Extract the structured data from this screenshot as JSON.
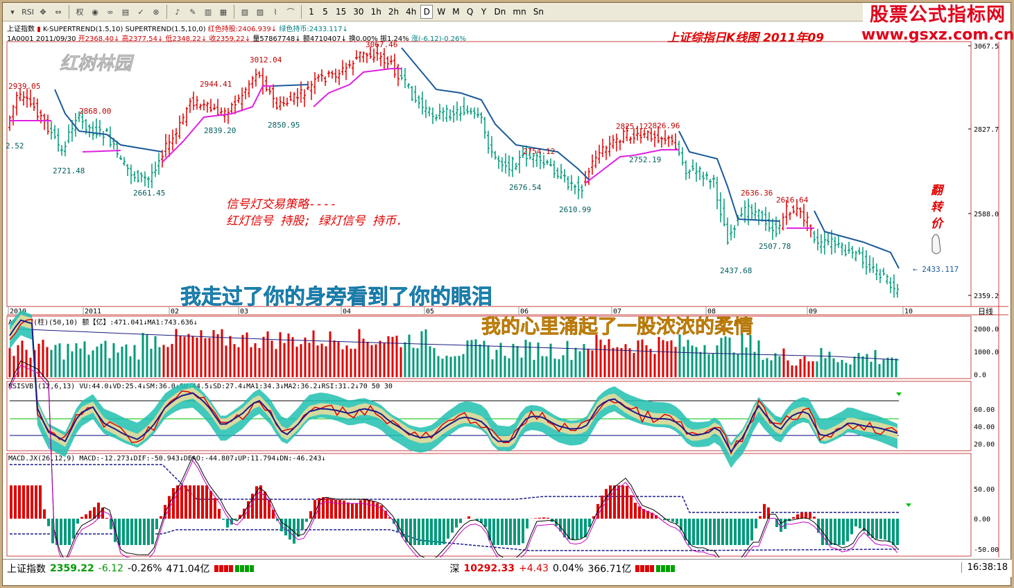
{
  "toolbar": {
    "items": [
      {
        "label": "▾",
        "name": "menu-dropdown-button"
      },
      {
        "label": "RSI",
        "name": "rsi-button"
      },
      {
        "label": "✥",
        "name": "move-icon"
      },
      {
        "label": "⇔",
        "name": "zoom-icon"
      },
      {
        "label": "权",
        "name": "rights-button"
      },
      {
        "label": "◉",
        "name": "toggle-icon"
      },
      {
        "label": "∞",
        "name": "link-icon"
      },
      {
        "label": "▤",
        "name": "book-icon"
      },
      {
        "label": "✓",
        "name": "check-icon"
      },
      {
        "label": "⊗",
        "name": "stop-icon"
      },
      {
        "label": "♪",
        "name": "alert-icon"
      },
      {
        "label": "✎",
        "name": "draw-icon"
      },
      {
        "label": "▥",
        "name": "layout1-icon"
      },
      {
        "label": "▦",
        "name": "layout2-icon"
      },
      {
        "label": "▧",
        "name": "layout3-icon"
      },
      {
        "label": "▨",
        "name": "layout4-icon"
      },
      {
        "label": "⌇",
        "name": "line-tool-icon"
      },
      {
        "label": "⌒",
        "name": "curve-tool-icon"
      }
    ],
    "periods": [
      "1",
      "5",
      "15",
      "30",
      "1h",
      "2h",
      "4h",
      "D",
      "W",
      "M",
      "Q",
      "Y",
      "Dn",
      "mn",
      "Sn"
    ],
    "active_period": "D"
  },
  "logo": {
    "line1": "股票公式指标网",
    "line2": "www.gsxz.com.cn"
  },
  "title": "上证综指日K线图 2011年09",
  "header1": {
    "name": "上证指数",
    "ind": "K-SUPERTREND(1.5,10) SUPERTREND(1.5,10,0)",
    "red": "红色持股:2406.939",
    "green": "绿色持币:2433.117"
  },
  "header2": {
    "code": "1A0001",
    "date": "2011/09/30",
    "open": "开2368.40",
    "high": "高2377.54",
    "low": "低2348.22",
    "close": "收2359.22",
    "vol": "量57867748",
    "amt": "额4710407",
    "turn": "换0.00%",
    "amp": "振1.24%",
    "chg": "涨(-6.12)-0.26%"
  },
  "watermark": "红树林园",
  "strategy": {
    "title": "信号灯交易策略----",
    "line": "红灯信号 持股; 绿灯信号 持币."
  },
  "lyric1": "我走过了你的身旁看到了你的眼泪",
  "lyric2": "我的心里涌起了一股浓浓的柔情",
  "flip_label": [
    "翻",
    "转",
    "价"
  ],
  "flip_value": "← 2433.117",
  "price_labels": [
    {
      "t": "2939.05"
    },
    {
      "t": "2.52"
    },
    {
      "t": "2721.48"
    },
    {
      "t": "2868.00"
    },
    {
      "t": "2661.45"
    },
    {
      "t": "2944.41"
    },
    {
      "t": "2839.20"
    },
    {
      "t": "3012.04"
    },
    {
      "t": "2850.95"
    },
    {
      "t": "3067.46"
    },
    {
      "t": "2754.12"
    },
    {
      "t": "2676.54"
    },
    {
      "t": "2610.99"
    },
    {
      "t": "2825.12"
    },
    {
      "t": "2826.96"
    },
    {
      "t": "2752.19"
    },
    {
      "t": "2636.36"
    },
    {
      "t": "2616.64"
    },
    {
      "t": "2507.78"
    },
    {
      "t": "2437.68"
    }
  ],
  "y_axis": {
    "main": [
      "3067.5",
      "2827.7",
      "2588.0",
      "2359.2"
    ],
    "amount": [
      "2000.0",
      "1000.0",
      "0.0"
    ],
    "rsi": [
      "60.00",
      "40.00",
      "20.00"
    ],
    "macd": [
      "50.00",
      "0.00",
      "-50.00"
    ]
  },
  "x_axis": [
    "2010",
    "2011",
    "02",
    "03",
    "04",
    "05",
    "06",
    "07",
    "08",
    "09",
    "10"
  ],
  "x_axis_right": "日线",
  "amount_hdr": {
    "name": "AMOUNT(柱)(50,10)",
    "val": "额【亿】:471.041",
    "ma": "MA1:743.636"
  },
  "rsi_hdr": {
    "name": "RSISVB.(12,6,13)",
    "vu": "VU:44.0",
    "vd": "VD:25.4",
    "sm": "SM:36.0",
    "su": "SU:44.5",
    "sd": "SD:27.4",
    "ma1": "MA1:34.3",
    "ma2": "MA2:36.2",
    "rsi": "RSI:31.2",
    "lv": "70 50 30"
  },
  "macd_hdr": {
    "name": "MACD.JX(26,12,9)",
    "macd": "MACD:-12.273",
    "dif": "DIF:-50.943",
    "dea": "DEAO:-44.807",
    "up": "UP:11.794",
    "dn": "DN:-46.243"
  },
  "status": {
    "sh_name": "上证指数",
    "sh_price": "2359.22",
    "sh_chg": "-6.12",
    "sh_pct": "-0.26%",
    "sh_amt": "471.04亿",
    "sz_name": "深",
    "sz_price": "10292.33",
    "sz_chg": "+4.43",
    "sz_pct": "0.04%",
    "sz_amt": "366.71亿",
    "time": "16:38:18"
  },
  "colors": {
    "up": "#e00000",
    "down": "#009a7a",
    "super_up": "#e020e0",
    "super_dn": "#1a5a9a"
  }
}
